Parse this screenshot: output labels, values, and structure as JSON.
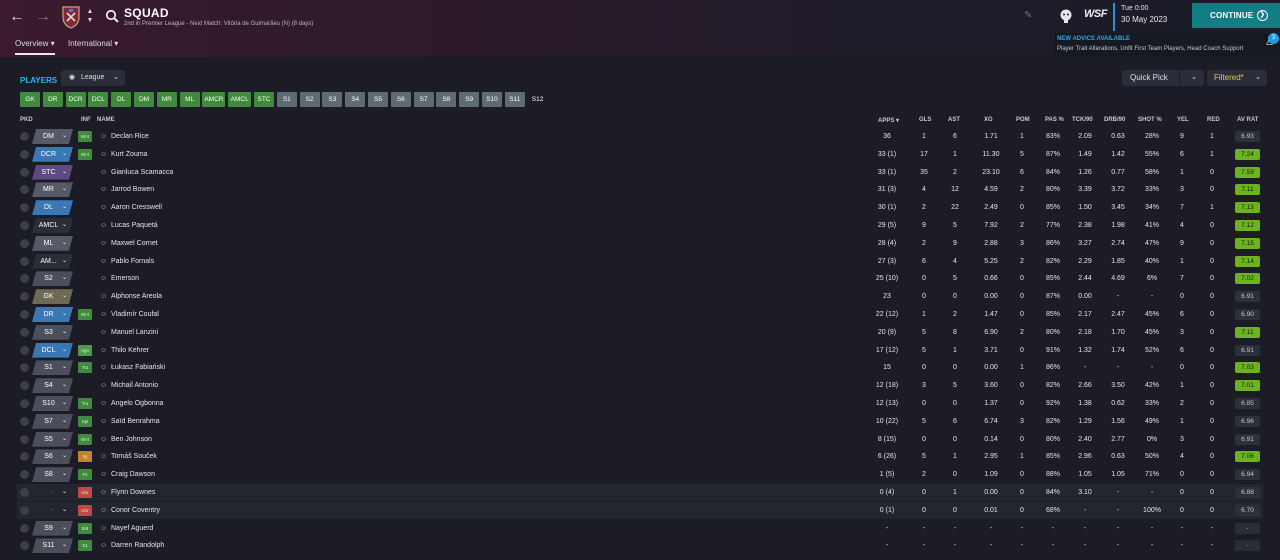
{
  "header": {
    "title": "SQUAD",
    "subtitle": "2nd in Premier League - Next Match: Vitória de Guimarães (N) (8 days)",
    "tabs": [
      "Overview",
      "International"
    ],
    "time": "Tue 0:00",
    "date": "30 May 2023",
    "continue_label": "CONTINUE",
    "advice_title": "NEW ADVICE AVAILABLE",
    "advice_text": "Player Trait Alterations, Unfit First Team Players, Head Coach Support",
    "advice_count": "3",
    "brand_label": "WSF"
  },
  "toolbar": {
    "players_label": "PLAYERS",
    "league_label": "League",
    "quick_pick_label": "Quick Pick",
    "filtered_label": "Filtered*"
  },
  "position_buttons": [
    "GK",
    "DR",
    "DCR",
    "DCL",
    "DL",
    "DM",
    "MR",
    "ML",
    "AMCR",
    "AMCL",
    "STC",
    "S1",
    "S2",
    "S3",
    "S4",
    "S5",
    "S6",
    "S7",
    "S8",
    "S9",
    "S10",
    "S11",
    "S12"
  ],
  "columns": [
    "PKD",
    "INF",
    "NAME",
    "APPS",
    "GLS",
    "AST",
    "XG",
    "POM",
    "PAS %",
    "TCK/90",
    "DRB/90",
    "SHOT %",
    "YEL",
    "RED",
    "AV RAT"
  ],
  "colors": {
    "gk": "#6f6a55",
    "def": "#3a78b5",
    "mid": "#575a66",
    "att": "#5d4a85",
    "sub": "#4c4f5b",
    "none": "#2b2d38"
  },
  "rows": [
    {
      "pos": "DM",
      "posc": "mid",
      "inf": "Wnt",
      "infc": "#3f8a3c",
      "name": "Declan Rice",
      "apps": "36",
      "gls": "1",
      "ast": "6",
      "xg": "1.71",
      "pom": "1",
      "pas": "83%",
      "tck": "2.09",
      "drb": "0.63",
      "shot": "28%",
      "yel": "9",
      "red": "1",
      "rat": "6.93",
      "ratc": "grey"
    },
    {
      "pos": "DCR",
      "posc": "def",
      "inf": "Wnt",
      "infc": "#3f8a3c",
      "name": "Kurt Zouma",
      "apps": "33 (1)",
      "gls": "17",
      "ast": "1",
      "xg": "11.30",
      "pom": "5",
      "pas": "87%",
      "tck": "1.49",
      "drb": "1.42",
      "shot": "55%",
      "yel": "6",
      "red": "1",
      "rat": "7.24",
      "ratc": "green"
    },
    {
      "pos": "STC",
      "posc": "att",
      "inf": "",
      "infc": "",
      "name": "Gianluca Scamacca",
      "apps": "33 (1)",
      "gls": "35",
      "ast": "2",
      "xg": "23.10",
      "pom": "6",
      "pas": "84%",
      "tck": "1.26",
      "drb": "0.77",
      "shot": "58%",
      "yel": "1",
      "red": "0",
      "rat": "7.59",
      "ratc": "green"
    },
    {
      "pos": "MR",
      "posc": "mid",
      "inf": "",
      "infc": "",
      "name": "Jarrod Bowen",
      "apps": "31 (3)",
      "gls": "4",
      "ast": "12",
      "xg": "4.59",
      "pom": "2",
      "pas": "80%",
      "tck": "3.39",
      "drb": "3.72",
      "shot": "33%",
      "yel": "3",
      "red": "0",
      "rat": "7.11",
      "ratc": "green"
    },
    {
      "pos": "DL",
      "posc": "def",
      "inf": "",
      "infc": "",
      "name": "Aaron Cresswell",
      "apps": "30 (1)",
      "gls": "2",
      "ast": "22",
      "xg": "2.49",
      "pom": "0",
      "pas": "85%",
      "tck": "1.50",
      "drb": "3.45",
      "shot": "34%",
      "yel": "7",
      "red": "1",
      "rat": "7.13",
      "ratc": "green"
    },
    {
      "pos": "AMCL",
      "posc": "none",
      "inf": "",
      "infc": "",
      "name": "Lucas Paquetá",
      "apps": "29 (5)",
      "gls": "9",
      "ast": "5",
      "xg": "7.92",
      "pom": "2",
      "pas": "77%",
      "tck": "2.38",
      "drb": "1.98",
      "shot": "41%",
      "yel": "4",
      "red": "0",
      "rat": "7.12",
      "ratc": "green"
    },
    {
      "pos": "ML",
      "posc": "mid",
      "inf": "",
      "infc": "",
      "name": "Maxwel Cornet",
      "apps": "28 (4)",
      "gls": "2",
      "ast": "9",
      "xg": "2.88",
      "pom": "3",
      "pas": "86%",
      "tck": "3.27",
      "drb": "2.74",
      "shot": "47%",
      "yel": "9",
      "red": "0",
      "rat": "7.15",
      "ratc": "green"
    },
    {
      "pos": "AM...",
      "posc": "none",
      "inf": "",
      "infc": "",
      "name": "Pablo Fornals",
      "apps": "27 (3)",
      "gls": "6",
      "ast": "4",
      "xg": "5.25",
      "pom": "2",
      "pas": "82%",
      "tck": "2.29",
      "drb": "1.85",
      "shot": "40%",
      "yel": "1",
      "red": "0",
      "rat": "7.14",
      "ratc": "green"
    },
    {
      "pos": "S2",
      "posc": "sub",
      "inf": "",
      "infc": "",
      "name": "Emerson",
      "apps": "25 (10)",
      "gls": "0",
      "ast": "5",
      "xg": "0.66",
      "pom": "0",
      "pas": "85%",
      "tck": "2.44",
      "drb": "4.69",
      "shot": "6%",
      "yel": "7",
      "red": "0",
      "rat": "7.02",
      "ratc": "green"
    },
    {
      "pos": "GK",
      "posc": "gk",
      "inf": "",
      "infc": "",
      "name": "Alphonse Areola",
      "apps": "23",
      "gls": "0",
      "ast": "0",
      "xg": "0.00",
      "pom": "0",
      "pas": "87%",
      "tck": "0.00",
      "drb": "-",
      "shot": "-",
      "yel": "0",
      "red": "0",
      "rat": "6.91",
      "ratc": "grey"
    },
    {
      "pos": "DR",
      "posc": "def",
      "inf": "Wnt",
      "infc": "#3f8a3c",
      "name": "Vladimír Coufal",
      "apps": "22 (12)",
      "gls": "1",
      "ast": "2",
      "xg": "1.47",
      "pom": "0",
      "pas": "85%",
      "tck": "2.17",
      "drb": "2.47",
      "shot": "45%",
      "yel": "6",
      "red": "0",
      "rat": "6.90",
      "ratc": "grey"
    },
    {
      "pos": "S3",
      "posc": "sub",
      "inf": "",
      "infc": "",
      "name": "Manuel Lanzini",
      "apps": "20 (9)",
      "gls": "5",
      "ast": "8",
      "xg": "6.90",
      "pom": "2",
      "pas": "80%",
      "tck": "2.18",
      "drb": "1.70",
      "shot": "45%",
      "yel": "3",
      "red": "0",
      "rat": "7.11",
      "ratc": "green"
    },
    {
      "pos": "DCL",
      "posc": "def",
      "inf": "Agn",
      "infc": "#4e9a4a",
      "name": "Thilo Kehrer",
      "apps": "17 (12)",
      "gls": "5",
      "ast": "1",
      "xg": "3.71",
      "pom": "0",
      "pas": "91%",
      "tck": "1.32",
      "drb": "1.74",
      "shot": "52%",
      "yel": "6",
      "red": "0",
      "rat": "6.91",
      "ratc": "grey"
    },
    {
      "pos": "S1",
      "posc": "sub",
      "inf": "Tra",
      "infc": "#3f8a3c",
      "name": "Łukasz Fabiański",
      "apps": "15",
      "gls": "0",
      "ast": "0",
      "xg": "0.00",
      "pom": "1",
      "pas": "86%",
      "tck": "-",
      "drb": "-",
      "shot": "-",
      "yel": "0",
      "red": "0",
      "rat": "7.03",
      "ratc": "green"
    },
    {
      "pos": "S4",
      "posc": "sub",
      "inf": "",
      "infc": "",
      "name": "Michail Antonio",
      "apps": "12 (18)",
      "gls": "3",
      "ast": "5",
      "xg": "3.60",
      "pom": "0",
      "pas": "82%",
      "tck": "2.66",
      "drb": "3.50",
      "shot": "42%",
      "yel": "1",
      "red": "0",
      "rat": "7.01",
      "ratc": "green"
    },
    {
      "pos": "S10",
      "posc": "sub",
      "inf": "Tra",
      "infc": "#3f8a3c",
      "name": "Angelo Ogbonna",
      "apps": "12 (13)",
      "gls": "0",
      "ast": "0",
      "xg": "1.37",
      "pom": "0",
      "pas": "92%",
      "tck": "1.38",
      "drb": "0.62",
      "shot": "33%",
      "yel": "2",
      "red": "0",
      "rat": "6.85",
      "ratc": "grey"
    },
    {
      "pos": "S7",
      "posc": "sub",
      "inf": "Spl",
      "infc": "#3f8a3c",
      "name": "Saïd Benrahma",
      "apps": "10 (22)",
      "gls": "5",
      "ast": "6",
      "xg": "6.74",
      "pom": "3",
      "pas": "82%",
      "tck": "1.29",
      "drb": "1.56",
      "shot": "49%",
      "yel": "1",
      "red": "0",
      "rat": "6.96",
      "ratc": "grey"
    },
    {
      "pos": "S5",
      "posc": "sub",
      "inf": "Wnt",
      "infc": "#3f8a3c",
      "name": "Ben Johnson",
      "apps": "8 (15)",
      "gls": "0",
      "ast": "0",
      "xg": "0.14",
      "pom": "0",
      "pas": "80%",
      "tck": "2.40",
      "drb": "2.77",
      "shot": "0%",
      "yel": "3",
      "red": "0",
      "rat": "6.91",
      "ratc": "grey"
    },
    {
      "pos": "S6",
      "posc": "sub",
      "inf": "Inj",
      "infc": "#c8822e",
      "name": "Tomáš Souček",
      "apps": "6 (26)",
      "gls": "5",
      "ast": "1",
      "xg": "2.95",
      "pom": "1",
      "pas": "85%",
      "tck": "2.96",
      "drb": "0.63",
      "shot": "50%",
      "yel": "4",
      "red": "0",
      "rat": "7.06",
      "ratc": "green"
    },
    {
      "pos": "S8",
      "posc": "sub",
      "inf": "Fit",
      "infc": "#3f8a3c",
      "name": "Craig Dawson",
      "apps": "1 (5)",
      "gls": "2",
      "ast": "0",
      "xg": "1.09",
      "pom": "0",
      "pas": "88%",
      "tck": "1.05",
      "drb": "1.05",
      "shot": "71%",
      "yel": "0",
      "red": "0",
      "rat": "6.94",
      "ratc": "grey"
    },
    {
      "pos": "-",
      "posc": "blank",
      "inf": "Unr",
      "infc": "#c24848",
      "name": "Flynn Downes",
      "apps": "0 (4)",
      "gls": "0",
      "ast": "1",
      "xg": "0.00",
      "pom": "0",
      "pas": "84%",
      "tck": "3.10",
      "drb": "-",
      "shot": "-",
      "yel": "0",
      "red": "0",
      "rat": "6.88",
      "ratc": "grey",
      "hl": true
    },
    {
      "pos": "-",
      "posc": "blank",
      "inf": "Unr",
      "infc": "#c24848",
      "name": "Conor Coventry",
      "apps": "0 (1)",
      "gls": "0",
      "ast": "0",
      "xg": "0.01",
      "pom": "0",
      "pas": "68%",
      "tck": "-",
      "drb": "-",
      "shot": "100%",
      "yel": "0",
      "red": "0",
      "rat": "6.70",
      "ratc": "grey",
      "hl": true
    },
    {
      "pos": "S9",
      "posc": "sub",
      "inf": "Bld",
      "infc": "#3f8a3c",
      "name": "Nayef Aguerd",
      "apps": "-",
      "gls": "-",
      "ast": "-",
      "xg": "-",
      "pom": "-",
      "pas": "-",
      "tck": "-",
      "drb": "-",
      "shot": "-",
      "yel": "-",
      "red": "-",
      "rat": "-",
      "ratc": "grey"
    },
    {
      "pos": "S11",
      "posc": "sub",
      "inf": "S1",
      "infc": "#3f8a3c",
      "name": "Darren Randolph",
      "apps": "-",
      "gls": "-",
      "ast": "-",
      "xg": "-",
      "pom": "-",
      "pas": "-",
      "tck": "-",
      "drb": "-",
      "shot": "-",
      "yel": "-",
      "red": "-",
      "rat": "-",
      "ratc": "grey"
    }
  ]
}
